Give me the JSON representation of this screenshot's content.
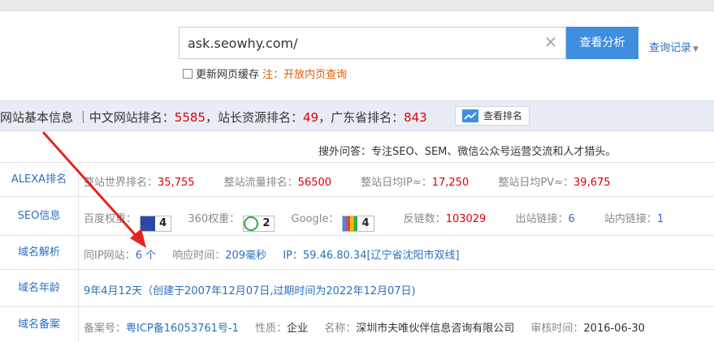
{
  "search": {
    "value": "ask.seowhy.com/",
    "clear_icon": "close-icon",
    "button_label": "查看分析",
    "history_label": "查询记录"
  },
  "cache": {
    "label": "更新网页缓存",
    "note": "注：开放内页查询"
  },
  "info_bar": {
    "prefix": "网站基本信息 ｜中文网站排名：",
    "cn_rank": "5585",
    "sep1": "，站长资源排名：",
    "webmaster_rank": "49",
    "sep2": "，广东省排名：",
    "gd_rank": "843",
    "button_label": "查看排名"
  },
  "ad_text": "搜外问答：专注SEO、SEM、微信公众号运营交流和人才猎头。",
  "alexa": {
    "label": "ALEXA排名",
    "world_rank_label": "整站世界排名：",
    "world_rank": "35,755",
    "traffic_rank_label": "整站流量排名：",
    "traffic_rank": "56500",
    "daily_ip_label": "整站日均IP≈：",
    "daily_ip": "17,250",
    "daily_pv_label": "整站日均PV≈：",
    "daily_pv": "39,675"
  },
  "seo": {
    "label": "SEO信息",
    "baidu_label": "百度权重：",
    "baidu_value": "4",
    "w360_label": "360权重：",
    "w360_value": "2",
    "google_label": "Google：",
    "google_value": "4",
    "backlinks_label": "反链数：",
    "backlinks": "103029",
    "outbound_label": "出站链接：",
    "outbound": "6",
    "inbound_label": "站内链接：",
    "inbound": "1"
  },
  "dns": {
    "label": "域名解析",
    "sameip_label": "同IP网站：",
    "sameip_value": "6 个",
    "response_label": "响应时间：",
    "response_value": "209毫秒",
    "ip_label": "IP：",
    "ip_value": "59.46.80.34[辽宁省沈阳市双线]"
  },
  "age": {
    "label": "域名年龄",
    "value": "9年4月12天（创建于2007年12月07日,过期时间为2022年12月07日)"
  },
  "icp": {
    "label": "域名备案",
    "no_label": "备案号：",
    "no_value": "粤ICP备16053761号-1",
    "nature_label": "性质：",
    "nature_value": "企业",
    "name_label": "名称：",
    "name_value": "深圳市夫唯伙伴信息咨询有限公司",
    "date_label": "审核时间：",
    "date_value": "2016-06-30"
  },
  "colors": {
    "accent": "#3f8ee0",
    "link": "#2a6fc1",
    "highlight": "#d9000d",
    "arrow": "#e8231f"
  }
}
